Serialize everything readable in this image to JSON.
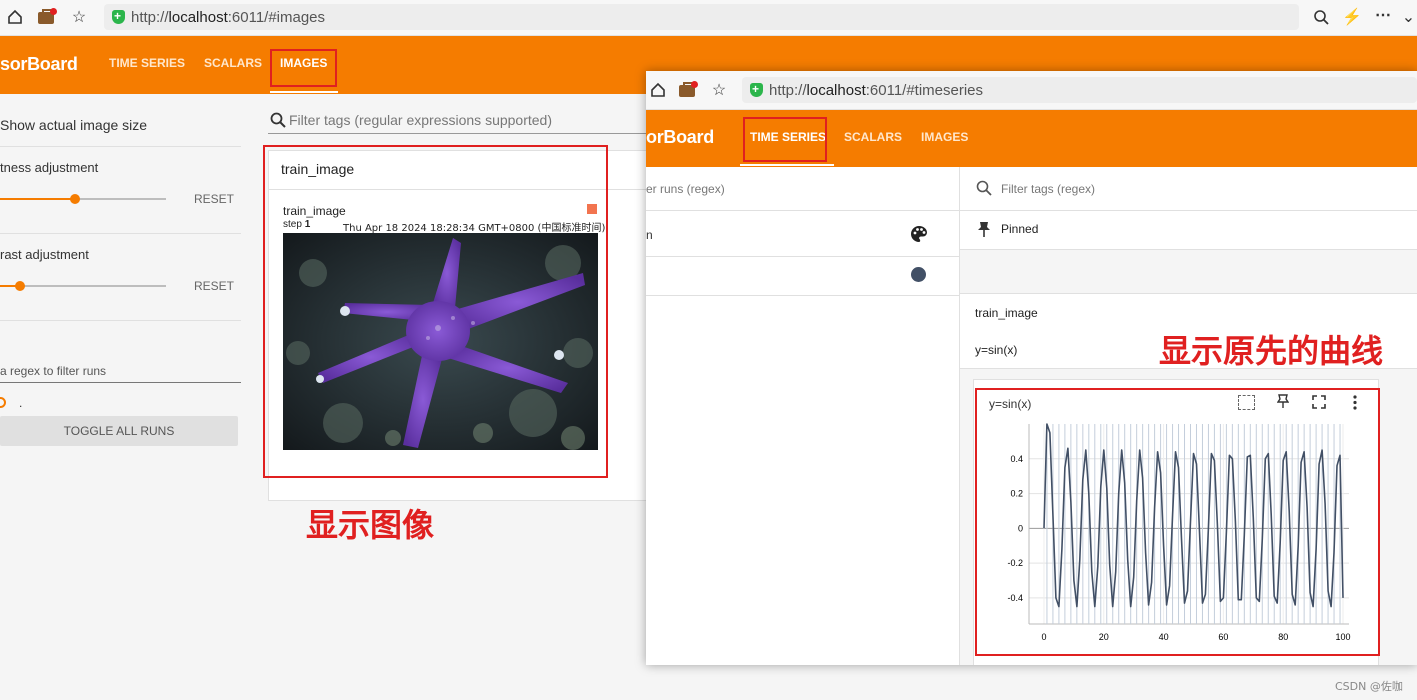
{
  "browser1": {
    "url_prefix": "http://",
    "url_host": "localhost",
    "url_rest": ":6011/#images"
  },
  "app1": {
    "title": "sorBoard",
    "tabs": [
      {
        "label": "TIME SERIES",
        "active": false
      },
      {
        "label": "SCALARS",
        "active": false
      },
      {
        "label": "IMAGES",
        "active": true
      }
    ]
  },
  "sidebar1": {
    "show_actual_size": "Show actual image size",
    "brightness_label": "tness adjustment",
    "brightness_value": 0.45,
    "contrast_label": "rast adjustment",
    "contrast_value": 0.12,
    "reset_label": "RESET",
    "runs_filter_placeholder": " a regex to filter runs",
    "run_item_label": ".",
    "toggle_all_runs": "TOGGLE ALL RUNS"
  },
  "main1": {
    "filter_placeholder": "Filter tags (regular expressions supported)",
    "card_title": "train_image",
    "image_tag": "train_image",
    "step_label": "step",
    "step_value": "1",
    "timestamp": "Thu Apr 18 2024 18:28:34 GMT+0800 (中国标准时间)"
  },
  "annotations": {
    "show_image": "显示图像",
    "show_curve": "显示原先的曲线"
  },
  "browser2": {
    "url_prefix": "http://",
    "url_host": "localhost",
    "url_rest": ":6011/#timeseries"
  },
  "app2": {
    "title": "orBoard",
    "tabs": [
      {
        "label": "TIME SERIES",
        "active": true
      },
      {
        "label": "SCALARS",
        "active": false
      },
      {
        "label": "IMAGES",
        "active": false
      }
    ]
  },
  "sidebar2": {
    "filter_runs_placeholder": "er runs (regex)",
    "run_row_label": "n"
  },
  "main2": {
    "filter_placeholder": "Filter tags (regex)",
    "pinned_label": "Pinned",
    "group_title": "train_image",
    "tag_title": "y=sin(x)",
    "chart_card_title": "y=sin(x)"
  },
  "colors": {
    "accent": "#f57c00",
    "annotation_red": "#e02020",
    "series_line": "#425066",
    "series_smoothed_bg": "#c4cedb"
  },
  "watermark": "CSDN @佐咖",
  "chart_data": {
    "type": "line",
    "title": "y=sin(x)",
    "xlabel": "",
    "ylabel": "",
    "x_ticks": [
      0,
      20,
      40,
      60,
      80,
      100
    ],
    "y_ticks": [
      -0.4,
      -0.2,
      0,
      0.2,
      0.4
    ],
    "xlim": [
      -5,
      102
    ],
    "ylim": [
      -0.55,
      0.6
    ],
    "grid": true,
    "series": [
      {
        "x": [
          0,
          1,
          2,
          3,
          4,
          5,
          6,
          7,
          8,
          9,
          10,
          11,
          12,
          13,
          14,
          15,
          16,
          17,
          18,
          19,
          20,
          21,
          22,
          23,
          24,
          25,
          26,
          27,
          28,
          29,
          30,
          31,
          32,
          33,
          34,
          35,
          36,
          37,
          38,
          39,
          40,
          41,
          42,
          43,
          44,
          45,
          46,
          47,
          48,
          49,
          50,
          51,
          52,
          53,
          54,
          55,
          56,
          57,
          58,
          59,
          60,
          61,
          62,
          63,
          64,
          65,
          66,
          67,
          68,
          69,
          70,
          71,
          72,
          73,
          74,
          75,
          76,
          77,
          78,
          79,
          80,
          81,
          82,
          83,
          84,
          85,
          86,
          87,
          88,
          89,
          90,
          91,
          92,
          93,
          94,
          95,
          96,
          97,
          98,
          99,
          100
        ],
        "y": [
          0.0,
          0.6,
          0.55,
          0.08,
          -0.4,
          -0.45,
          -0.12,
          0.35,
          0.46,
          0.15,
          -0.3,
          -0.45,
          -0.18,
          0.28,
          0.45,
          0.2,
          -0.25,
          -0.45,
          -0.22,
          0.24,
          0.45,
          0.23,
          -0.21,
          -0.45,
          -0.25,
          0.2,
          0.45,
          0.26,
          -0.18,
          -0.45,
          -0.28,
          0.16,
          0.45,
          0.29,
          -0.14,
          -0.44,
          -0.31,
          0.12,
          0.44,
          0.32,
          -0.1,
          -0.44,
          -0.33,
          0.08,
          0.44,
          0.35,
          -0.06,
          -0.43,
          -0.36,
          0.04,
          0.43,
          0.37,
          -0.02,
          -0.43,
          -0.38,
          0.0,
          0.43,
          0.39,
          0.02,
          -0.42,
          -0.4,
          -0.02,
          0.42,
          0.4,
          0.04,
          -0.41,
          -0.41,
          -0.04,
          0.41,
          0.42,
          0.06,
          -0.4,
          -0.42,
          -0.06,
          0.4,
          0.43,
          0.08,
          -0.39,
          -0.43,
          -0.08,
          0.39,
          0.44,
          0.1,
          -0.38,
          -0.44,
          -0.1,
          0.38,
          0.44,
          0.12,
          -0.37,
          -0.45,
          -0.12,
          0.37,
          0.45,
          0.14,
          -0.36,
          -0.45,
          -0.14,
          0.36,
          0.42,
          -0.4
        ]
      }
    ]
  }
}
